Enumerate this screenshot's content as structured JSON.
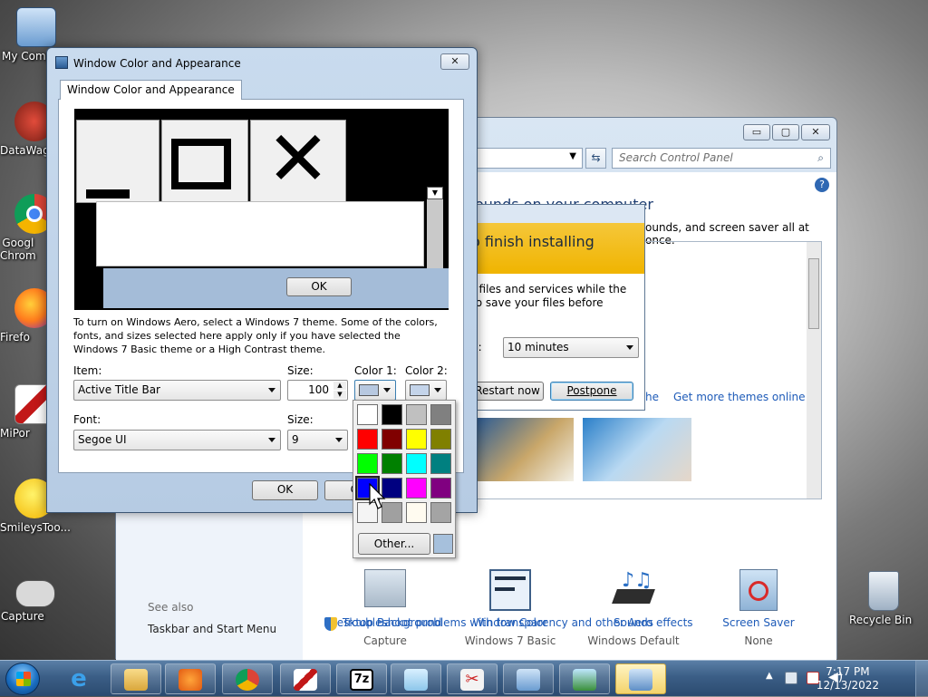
{
  "desktop": {
    "icons": [
      {
        "label": "My Comp",
        "icon": "computer-icon"
      },
      {
        "label": "DataWag",
        "icon": "shortcut-icon"
      },
      {
        "label": "Googl\nChrom",
        "icon": "chrome-icon"
      },
      {
        "label": "Firefo",
        "icon": "firefox-icon"
      },
      {
        "label": "MiPor",
        "icon": "mipony-icon"
      },
      {
        "label": "SmileysToo...",
        "icon": "smiley-icon"
      },
      {
        "label": "Capture",
        "icon": "capture-icon"
      },
      {
        "label": "Recycle Bin",
        "icon": "recycle-bin-icon"
      }
    ]
  },
  "control_panel": {
    "search_placeholder": "Search Control Panel",
    "heading_partial": "ounds on your computer",
    "description_partial": "ounds, and screen saver all at once.",
    "get_more_themes": "Get more themes online",
    "theme_link_partial": "he",
    "bottom_items": [
      {
        "title": "Desktop Background",
        "subtitle": "Capture",
        "icon": "desktop-background-icon"
      },
      {
        "title": "Window Color",
        "subtitle": "Windows 7 Basic",
        "icon": "window-color-icon"
      },
      {
        "title": "Sounds",
        "subtitle": "Windows Default",
        "icon": "sounds-icon"
      },
      {
        "title": "Screen Saver",
        "subtitle": "None",
        "icon": "screen-saver-icon"
      }
    ],
    "see_also": "See also",
    "taskbar_link": "Taskbar and Start Menu",
    "troubleshoot_link": "Troubleshoot problems with transparency and other Aero effects"
  },
  "update_dialog": {
    "banner": "o finish installing",
    "text_line1": "t files and services while the",
    "text_line2": "to save your files before",
    "remind_label_partial": "n:",
    "remind_value": "10 minutes",
    "restart_button": "Restart now",
    "postpone_button": "Postpone"
  },
  "wca_dialog": {
    "title": "Window Color and Appearance",
    "tab": "Window Color and Appearance",
    "preview_ok": "OK",
    "info_text": "To turn on Windows Aero, select a Windows 7 theme.  Some of the colors, fonts, and sizes selected here apply only if you have selected the Windows 7 Basic theme or a High Contrast theme.",
    "item_label": "Item:",
    "item_value": "Active Title Bar",
    "size_label": "Size:",
    "size_value": "100",
    "color1_label": "Color 1:",
    "color2_label": "Color 2:",
    "font_label": "Font:",
    "font_value": "Segoe UI",
    "font_size_label": "Size:",
    "font_size_value": "9",
    "ok_button": "OK",
    "cancel_button_partial": "Ca",
    "color1_value": "#b7c8e0",
    "color2_value": "#c4d4ea"
  },
  "palette": {
    "colors": [
      "#ffffff",
      "#000000",
      "#c0c0c0",
      "#808080",
      "#ff0000",
      "#800000",
      "#ffff00",
      "#808000",
      "#00ff00",
      "#008000",
      "#00ffff",
      "#008080",
      "#0000ff",
      "#000080",
      "#ff00ff",
      "#800080",
      "#f4f4f4",
      "#a0a0a0",
      "#fffbf0",
      "#a4a4a4"
    ],
    "selected_index": 12,
    "other_button": "Other...",
    "custom_color": "#a6c0dc"
  },
  "taskbar": {
    "time": "7:17 PM",
    "date": "12/13/2022"
  }
}
